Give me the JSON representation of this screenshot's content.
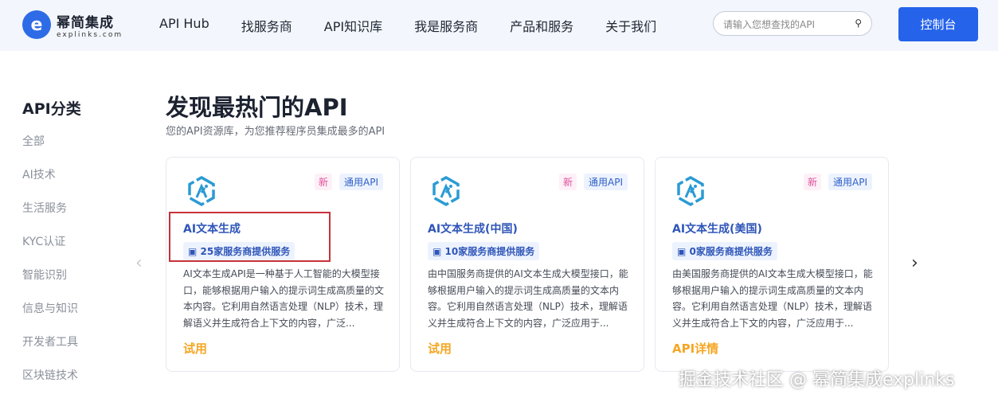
{
  "header": {
    "logo_cn": "幂简集成",
    "logo_en": "explinks.com",
    "nav": [
      "API Hub",
      "找服务商",
      "API知识库",
      "我是服务商",
      "产品和服务",
      "关于我们"
    ],
    "search_placeholder": "请输入您想查找的API",
    "console": "控制台"
  },
  "sidebar": {
    "title": "API分类",
    "items": [
      "全部",
      "AI技术",
      "生活服务",
      "KYC认证",
      "智能识别",
      "信息与知识",
      "开发者工具",
      "区块链技术"
    ]
  },
  "main": {
    "title": "发现最热门的API",
    "subtitle": "您的API资源库，为您推荐程序员集成最多的API",
    "cards": [
      {
        "tag_new": "新",
        "tag_type": "通用API",
        "title": "AI文本生成",
        "providers": "25家服务商提供服务",
        "desc": "AI文本生成API是一种基于人工智能的大模型接口，能够根据用户输入的提示词生成高质量的文本内容。它利用自然语言处理（NLP）技术，理解语义并生成符合上下文的内容，广泛...",
        "action": "试用"
      },
      {
        "tag_new": "新",
        "tag_type": "通用API",
        "title": "AI文本生成(中国)",
        "providers": "10家服务商提供服务",
        "desc": "由中国服务商提供的AI文本生成大模型接口，能够根据用户输入的提示词生成高质量的文本内容。它利用自然语言处理（NLP）技术，理解语义并生成符合上下文的内容，广泛应用于...",
        "action": "试用"
      },
      {
        "tag_new": "新",
        "tag_type": "通用API",
        "title": "AI文本生成(美国)",
        "providers": "0家服务商提供服务",
        "desc": "由美国服务商提供的AI文本生成大模型接口，能够根据用户输入的提示词生成高质量的文本内容。它利用自然语言处理（NLP）技术，理解语义并生成符合上下文的内容，广泛应用于...",
        "action": "API详情"
      }
    ]
  },
  "watermark": "掘金技术社区 @ 幂简集成explinks"
}
